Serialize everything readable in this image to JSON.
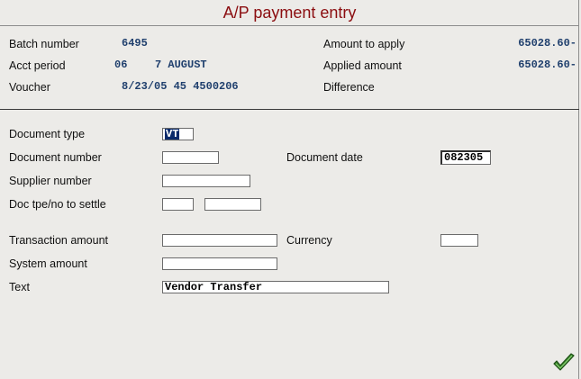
{
  "title": "A/P payment entry",
  "header": {
    "batch_number_label": "Batch number",
    "batch_number": "6495",
    "acct_period_label": "Acct period",
    "acct_period_num": "06",
    "acct_period_month": "7 AUGUST",
    "voucher_label": "Voucher",
    "voucher_value": "8/23/05 45  4500206",
    "amount_to_apply_label": "Amount to apply",
    "amount_to_apply": "65028.60-",
    "applied_amount_label": "Applied amount",
    "applied_amount": "65028.60-",
    "difference_label": "Difference",
    "difference": ""
  },
  "form": {
    "document_type_label": "Document type",
    "document_type": "VT",
    "document_number_label": "Document number",
    "document_number": "",
    "document_date_label": "Document date",
    "document_date": "082305",
    "supplier_number_label": "Supplier number",
    "supplier_number": "",
    "doc_type_no_settle_label": "Doc tpe/no to settle",
    "doc_type_settle": "",
    "doc_no_settle": "",
    "transaction_amount_label": "Transaction amount",
    "transaction_amount": "",
    "currency_label": "Currency",
    "currency": "",
    "system_amount_label": "System amount",
    "system_amount": "",
    "text_label": "Text",
    "text": "Vendor Transfer"
  },
  "icons": {
    "confirm": "checkmark-icon"
  },
  "colors": {
    "title": "#8b0d10",
    "values": "#1f3f6d",
    "background": "#ecebe8"
  }
}
